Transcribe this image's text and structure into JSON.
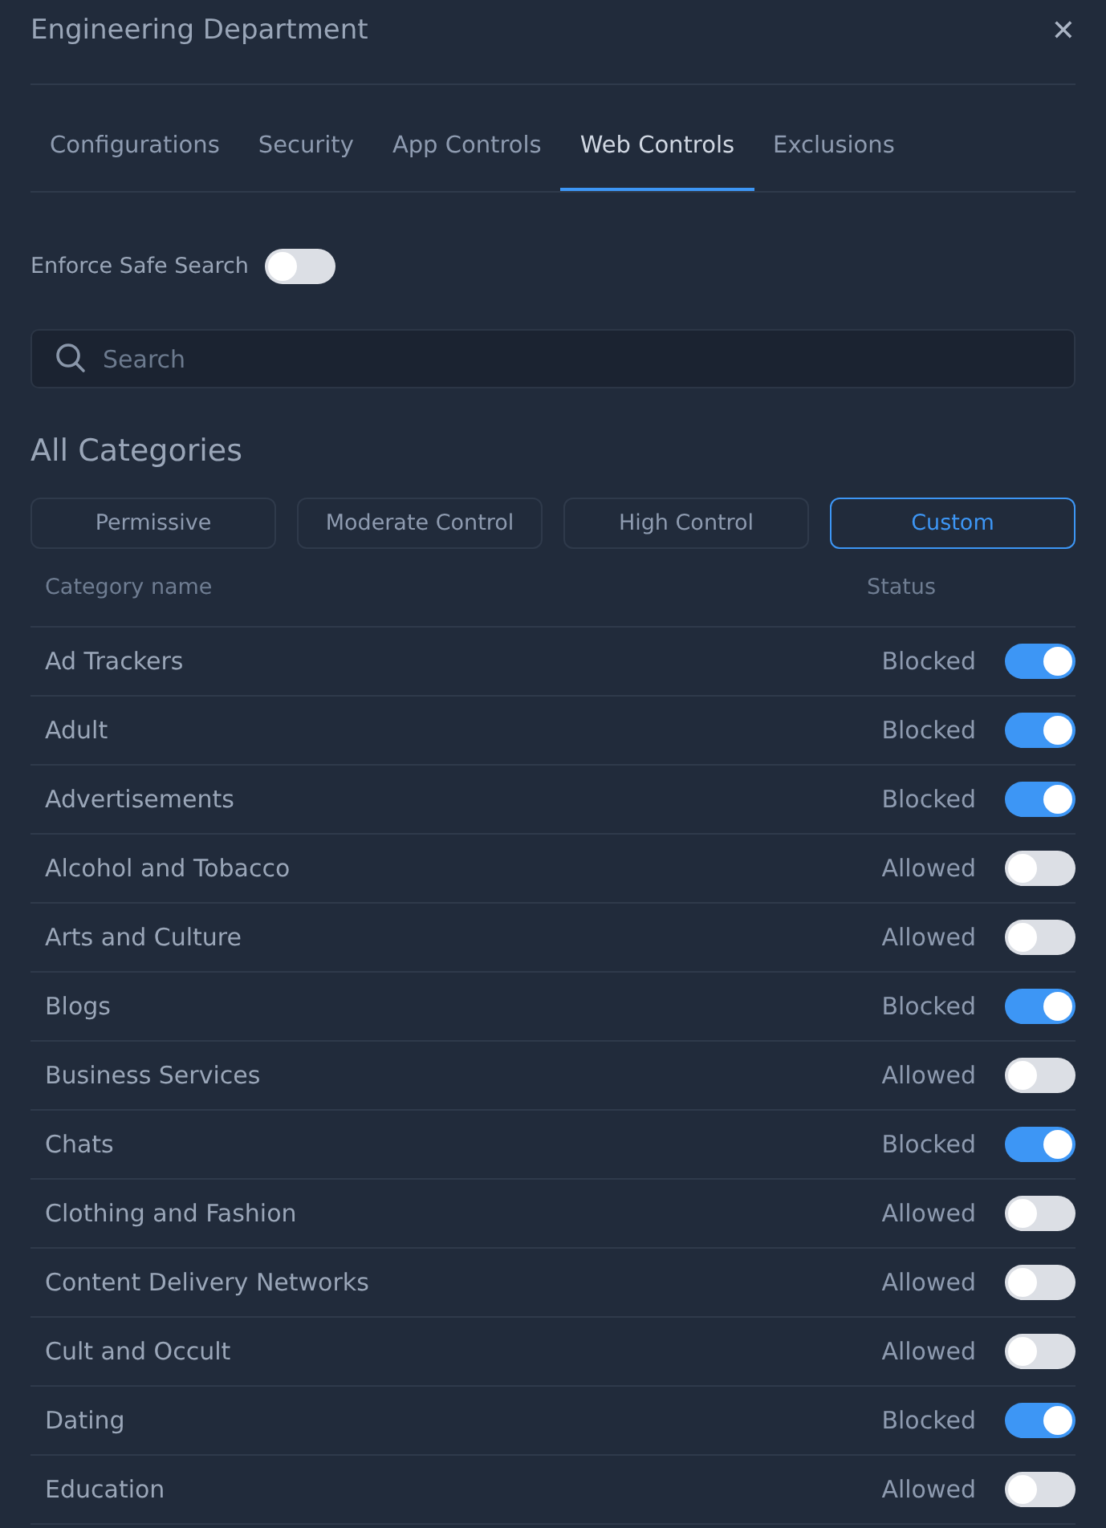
{
  "window": {
    "title": "Engineering Department",
    "close": "✕"
  },
  "tabs": [
    {
      "label": "Configurations",
      "selected": false
    },
    {
      "label": "Security",
      "selected": false
    },
    {
      "label": "App Controls",
      "selected": false
    },
    {
      "label": "Web Controls",
      "selected": true
    },
    {
      "label": "Exclusions",
      "selected": false
    }
  ],
  "safe_search": {
    "label": "Enforce Safe Search",
    "on": false
  },
  "search": {
    "placeholder": "Search"
  },
  "section_title": "All Categories",
  "presets": [
    {
      "label": "Permissive",
      "selected": false
    },
    {
      "label": "Moderate Control",
      "selected": false
    },
    {
      "label": "High Control",
      "selected": false
    },
    {
      "label": "Custom",
      "selected": true
    }
  ],
  "table": {
    "columns": [
      "Category name",
      "Status"
    ],
    "rows": [
      {
        "name": "Ad Trackers",
        "status": "Blocked",
        "on": true
      },
      {
        "name": "Adult",
        "status": "Blocked",
        "on": true
      },
      {
        "name": "Advertisements",
        "status": "Blocked",
        "on": true
      },
      {
        "name": "Alcohol and Tobacco",
        "status": "Allowed",
        "on": false
      },
      {
        "name": "Arts and Culture",
        "status": "Allowed",
        "on": false
      },
      {
        "name": "Blogs",
        "status": "Blocked",
        "on": true
      },
      {
        "name": "Business Services",
        "status": "Allowed",
        "on": false
      },
      {
        "name": "Chats",
        "status": "Blocked",
        "on": true
      },
      {
        "name": "Clothing and Fashion",
        "status": "Allowed",
        "on": false
      },
      {
        "name": "Content Delivery Networks",
        "status": "Allowed",
        "on": false
      },
      {
        "name": "Cult and Occult",
        "status": "Allowed",
        "on": false
      },
      {
        "name": "Dating",
        "status": "Blocked",
        "on": true
      },
      {
        "name": "Education",
        "status": "Allowed",
        "on": false
      }
    ]
  }
}
